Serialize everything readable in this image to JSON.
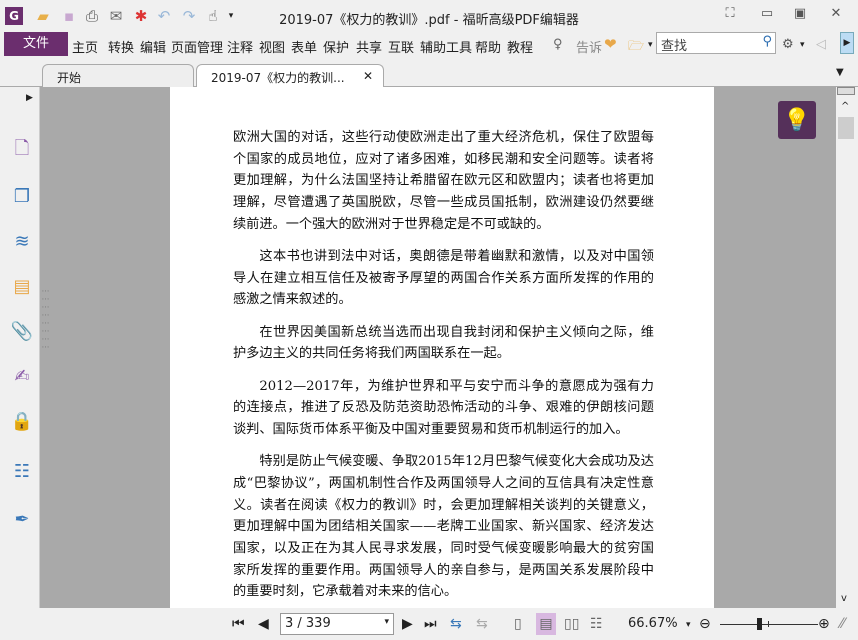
{
  "title": "2019-07《权力的教训》.pdf - 福昕高级PDF编辑器",
  "quick_access": [
    "app-logo",
    "open-icon",
    "save-icon",
    "print-icon",
    "email-icon",
    "new-icon",
    "undo-icon",
    "redo-icon",
    "hand-tool-icon"
  ],
  "menu": {
    "file": "文件",
    "items": [
      "主页",
      "转换",
      "编辑",
      "页面管理",
      "注释",
      "视图",
      "表单",
      "保护",
      "共享",
      "互联",
      "辅助工具",
      "帮助",
      "教程"
    ],
    "tell_me": "告诉",
    "search_placeholder": "查找"
  },
  "tabs": [
    {
      "label": "开始"
    },
    {
      "label": "2019-07《权力的教训...",
      "active": true
    }
  ],
  "sidebar": [
    "bookmark-icon",
    "pages-icon",
    "layers-icon",
    "comments-icon",
    "attachments-icon",
    "signatures-icon",
    "security-icon",
    "form-fields-icon",
    "certify-icon"
  ],
  "document": {
    "paragraphs": [
      {
        "indent": false,
        "text": "欧洲大国的对话，这些行动使欧洲走出了重大经济危机，保住了欧盟每个国家的成员地位，应对了诸多困难，如移民潮和安全问题等。读者将更加理解，为什么法国坚持让希腊留在欧元区和欧盟内；读者也将更加理解，尽管遭遇了英国脱欧，尽管一些成员国抵制，欧洲建设仍然要继续前进。一个强大的欧洲对于世界稳定是不可或缺的。"
      },
      {
        "indent": true,
        "text": "这本书也讲到法中对话，奥朗德是带着幽默和激情，以及对中国领导人在建立相互信任及被寄予厚望的两国合作关系方面所发挥的作用的感激之情来叙述的。"
      },
      {
        "indent": true,
        "text": "在世界因美国新总统当选而出现自我封闭和保护主义倾向之际，维护多边主义的共同任务将我们两国联系在一起。"
      },
      {
        "indent": true,
        "text": "2012—2017年，为维护世界和平与安宁而斗争的意愿成为强有力的连接点，推进了反恐及防范资助恐怖活动的斗争、艰难的伊朗核问题谈判、国际货币体系平衡及中国对重要贸易和货币机制运行的加入。"
      },
      {
        "indent": true,
        "text": "特别是防止气候变暖、争取2015年12月巴黎气候变化大会成功及达成“巴黎协议”，两国机制性合作及两国领导人之间的互信具有决定性意义。读者在阅读《权力的教训》时，会更加理解相关谈判的关键意义，更加理解中国为团结相关国家——老牌工业国家、新兴国家、经济发达国家，以及正在为其人民寻求发展，同时受气候变暖影响最大的贫穷国家所发挥的重要作用。两国领导人的亲自参与，是两国关系发展阶段中的重要时刻，它承载着对未来的信心。"
      },
      {
        "indent": true,
        "text": "当前，多边主义遇到困难，自由贸易被打上问号，美国不再参"
      }
    ]
  },
  "status": {
    "page": "3 / 339",
    "zoom": "66.67%",
    "zoom_fraction": 0.4
  },
  "colors": {
    "accent": "#6b2e6e",
    "tip_bg": "#55305a"
  }
}
